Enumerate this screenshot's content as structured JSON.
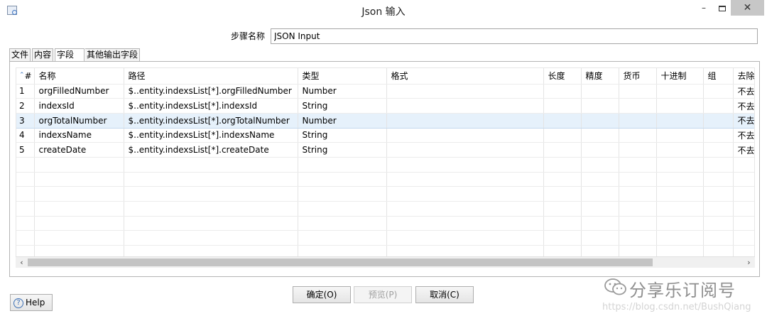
{
  "window": {
    "title": "Json 输入",
    "minimize": "–",
    "close": "✕"
  },
  "step": {
    "label": "步骤名称",
    "value": "JSON Input"
  },
  "tabs": [
    "文件",
    "内容",
    "字段",
    "其他输出字段"
  ],
  "table": {
    "columns": [
      "#",
      "名称",
      "路径",
      "类型",
      "格式",
      "长度",
      "精度",
      "货币",
      "十进制",
      "组",
      "去除"
    ],
    "rows": [
      [
        "1",
        "orgFilledNumber",
        "$..entity.indexsList[*].orgFilledNumber",
        "Number",
        "",
        "",
        "",
        "",
        "",
        "",
        "不去"
      ],
      [
        "2",
        "indexsId",
        "$..entity.indexsList[*].indexsId",
        "String",
        "",
        "",
        "",
        "",
        "",
        "",
        "不去"
      ],
      [
        "3",
        "orgTotalNumber",
        "$..entity.indexsList[*].orgTotalNumber",
        "Number",
        "",
        "",
        "",
        "",
        "",
        "",
        "不去"
      ],
      [
        "4",
        "indexsName",
        "$..entity.indexsList[*].indexsName",
        "String",
        "",
        "",
        "",
        "",
        "",
        "",
        "不去"
      ],
      [
        "5",
        "createDate",
        "$..entity.indexsList[*].createDate",
        "String",
        "",
        "",
        "",
        "",
        "",
        "",
        "不去"
      ]
    ],
    "selected_row": 3
  },
  "buttons": {
    "ok": "确定(O)",
    "preview": "预览(P)",
    "cancel": "取消(C)",
    "help": "Help"
  },
  "watermark": {
    "text": "分享乐订阅号",
    "url": "https://blog.csdn.net/BushQiang"
  }
}
